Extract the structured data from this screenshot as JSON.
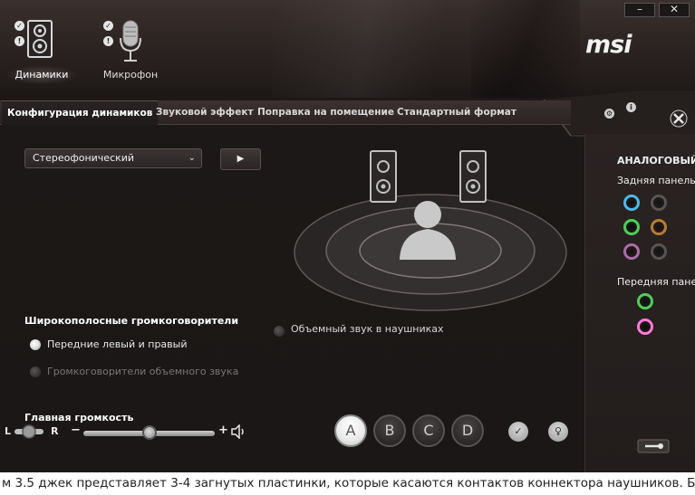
{
  "devices": [
    {
      "label": "Динамики",
      "active": true
    },
    {
      "label": "Микрофон",
      "active": false
    }
  ],
  "window": {
    "minimize": "–",
    "close": "✕"
  },
  "logo": "msi",
  "tabs": [
    "Конфигурация динамиков",
    "Звуковой эффект",
    "Поправка на помещение",
    "Стандартный формат"
  ],
  "config": {
    "selected": "Стереофонический",
    "play_label": "▶"
  },
  "fullrange": {
    "title": "Широкополосные громкоговорители",
    "options": [
      {
        "label": "Передние левый и правый",
        "checked": true
      },
      {
        "label": "Громкоговорители объемного звука",
        "checked": false
      }
    ]
  },
  "headphone": {
    "label": "Объемный звук в наушниках",
    "checked": false
  },
  "volume": {
    "title": "Главная громкость",
    "left": "L",
    "right": "R",
    "minus": "−",
    "plus": "+",
    "level": 0.5
  },
  "presets": [
    "A",
    "B",
    "C",
    "D"
  ],
  "active_preset": "A",
  "right_panel": {
    "title": "АНАЛОГОВЫЙ",
    "rear_label": "Задняя панель",
    "front_label": "Передняя панель",
    "rear_jacks": [
      {
        "color": "#4fb8e8",
        "active": true
      },
      {
        "color": "#6a6666",
        "active": false
      },
      {
        "color": "#4dcf5a",
        "active": true
      },
      {
        "color": "#e89a3a",
        "active": false
      },
      {
        "color": "#d985d6",
        "active": false
      },
      {
        "color": "#6a6666",
        "active": false
      }
    ],
    "front_jacks": [
      {
        "color": "#4dcf5a",
        "active": true
      },
      {
        "color": "#ff7ad6",
        "active": true
      }
    ]
  },
  "caption": "м 3.5 джек представляет 3-4 загнутых пластинки, которые касаются контактов коннектора наушников. Банально не"
}
